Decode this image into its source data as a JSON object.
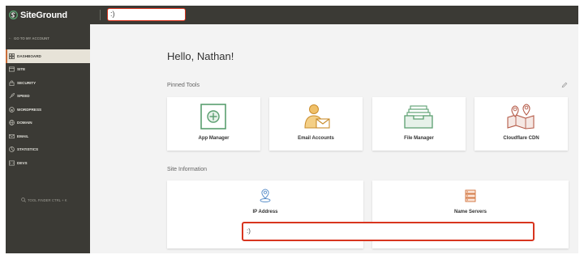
{
  "header": {
    "logo_text": "SiteGround",
    "search_value": ":)"
  },
  "sidebar": {
    "back_label": "GO TO MY ACCOUNT",
    "items": [
      {
        "label": "DASHBOARD",
        "icon": "dashboard-icon",
        "active": true
      },
      {
        "label": "SITE",
        "icon": "site-icon"
      },
      {
        "label": "SECURITY",
        "icon": "lock-icon"
      },
      {
        "label": "SPEED",
        "icon": "rocket-icon"
      },
      {
        "label": "WORDPRESS",
        "icon": "wordpress-icon"
      },
      {
        "label": "DOMAIN",
        "icon": "globe-icon"
      },
      {
        "label": "EMAIL",
        "icon": "envelope-icon"
      },
      {
        "label": "STATISTICS",
        "icon": "statistics-icon"
      },
      {
        "label": "DEVS",
        "icon": "code-icon"
      }
    ],
    "tool_finder_label": "TOOL FINDER CTRL + K"
  },
  "main": {
    "greeting": "Hello, Nathan!",
    "pinned_tools_title": "Pinned Tools",
    "pinned_tools": [
      {
        "label": "App Manager",
        "icon": "app-manager-icon"
      },
      {
        "label": "Email Accounts",
        "icon": "email-accounts-icon"
      },
      {
        "label": "File Manager",
        "icon": "file-manager-icon"
      },
      {
        "label": "Cloudflare CDN",
        "icon": "cloudflare-cdn-icon"
      }
    ],
    "site_info_title": "Site Information",
    "site_info": [
      {
        "label": "IP Address",
        "icon": "location-pin-icon"
      },
      {
        "label": "Name Servers",
        "icon": "server-icon"
      }
    ],
    "site_info_value": ":)"
  },
  "colors": {
    "sidebar_bg": "#3b3a35",
    "accent": "#c96e3a",
    "highlight_red": "#d8351f",
    "icon_green": "#5a9e6f",
    "icon_orange": "#e0a040"
  }
}
